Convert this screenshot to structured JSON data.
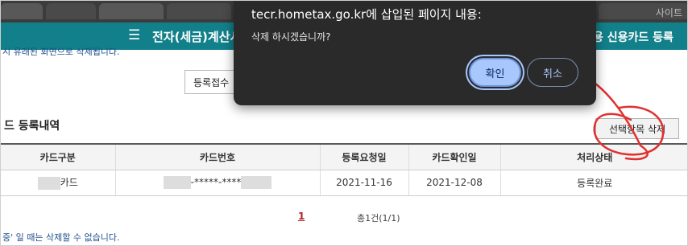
{
  "browser": {
    "tab_hint_text": "사이트",
    "dialog": {
      "origin_title": "tecr.hometax.go.kr에 삽입된 페이지 내용:",
      "message": "삭제 하시겠습니까?",
      "ok_label": "확인",
      "cancel_label": "취소"
    }
  },
  "site": {
    "title": "전자(세금)계산서",
    "right_menu": "용 신용카드 등록",
    "top_note": "시 유래된 화면으로 삭제됩니다.",
    "register_button": "등록접수",
    "section_title": "드 등록내역",
    "delete_selected_button": "선택항목 삭제",
    "table": {
      "headers": [
        "카드구분",
        "카드번호",
        "등록요청일",
        "카드확인일",
        "처리상태"
      ],
      "rows": [
        {
          "card_type": "카드",
          "card_number": "-*****-****",
          "request_date": "2021-11-16",
          "confirm_date": "2021-12-08",
          "status": "등록완료"
        }
      ]
    },
    "pagination": {
      "current_page": "1",
      "total": "총1건(1/1)"
    },
    "bottom_note": "중' 일 때는 삭제할 수 없습니다."
  },
  "annotation": {
    "color": "#e03030"
  }
}
